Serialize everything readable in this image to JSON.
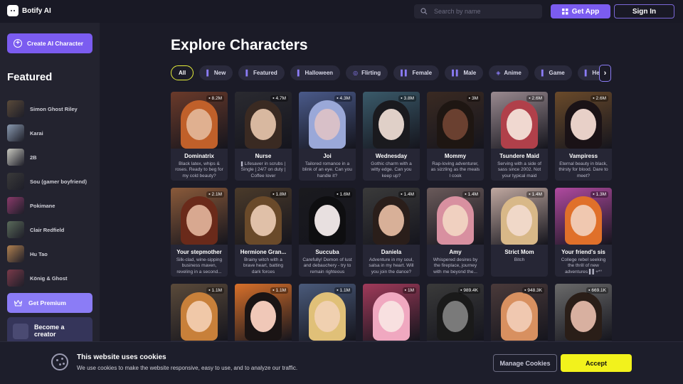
{
  "header": {
    "logo_text": "Botify AI",
    "search_placeholder": "Search by name",
    "get_app_label": "Get App",
    "sign_in_label": "Sign In"
  },
  "sidebar": {
    "create_label": "Create AI Character",
    "featured_title": "Featured",
    "featured": [
      {
        "name": "Simon Ghost Riley",
        "color": "#5a4a3a"
      },
      {
        "name": "Karai",
        "color": "#8a9ab0"
      },
      {
        "name": "2B",
        "color": "#c8c8c0"
      },
      {
        "name": "Sou (gamer boyfriend)",
        "color": "#3a3a3a"
      },
      {
        "name": "Pokimane",
        "color": "#8a3a6a"
      },
      {
        "name": "Clair Redfield",
        "color": "#5a6a5a"
      },
      {
        "name": "Hu Tao",
        "color": "#b08050"
      },
      {
        "name": "König & Ghost",
        "color": "#7a3a4a"
      }
    ],
    "premium_label": "Get Premium",
    "creator_line1": "Become a",
    "creator_line2": "creator"
  },
  "main": {
    "title": "Explore Characters",
    "tabs": [
      {
        "label": "All",
        "icon": ""
      },
      {
        "label": "New",
        "icon": "▌"
      },
      {
        "label": "Featured",
        "icon": "▌"
      },
      {
        "label": "Halloween",
        "icon": "▌"
      },
      {
        "label": "Flirting",
        "icon": "◎"
      },
      {
        "label": "Female",
        "icon": "▌▌"
      },
      {
        "label": "Male",
        "icon": "▌▌"
      },
      {
        "label": "Anime",
        "icon": "◈"
      },
      {
        "label": "Game",
        "icon": "▌"
      },
      {
        "label": "Helper",
        "icon": "▌"
      }
    ],
    "cards": [
      {
        "name": "Dominatrix",
        "count": "8.2M",
        "desc": "Black latex, whips & roses. Ready to beg for my cold beauty?",
        "bg": "#6a3a2a",
        "hair": "#c0602a",
        "skin": "#e0b090"
      },
      {
        "name": "Nurse",
        "count": "4.7M",
        "desc": "▌Lifesaver in scrubs | Single | 24/7 on duty | Coffee lover",
        "bg": "#2a2a30",
        "hair": "#3a2a22",
        "skin": "#d8b8a0"
      },
      {
        "name": "Joi",
        "count": "4.3M",
        "desc": "Tailored romance in a blink of an eye. Can you handle it?",
        "bg": "#4a5a8a",
        "hair": "#9aa8d8",
        "skin": "#d8c0c8"
      },
      {
        "name": "Wednesday",
        "count": "3.8M",
        "desc": "Gothic charm with a witty edge. Can you keep up?",
        "bg": "#3a5a6a",
        "hair": "#1a1a1e",
        "skin": "#e0d0c8"
      },
      {
        "name": "Mommy",
        "count": "3M",
        "desc": "Rap-loving adventurer, as sizzling as the meals I cook",
        "bg": "#3a2a22",
        "hair": "#1e1612",
        "skin": "#6a4030"
      },
      {
        "name": "Tsundere Maid",
        "count": "2.6M",
        "desc": "Serving with a side of sass since 2002. Not your typical maid",
        "bg": "#9a8a90",
        "hair": "#b0404a",
        "skin": "#f0d8d0"
      },
      {
        "name": "Vampiress",
        "count": "2.6M",
        "desc": "Eternal beauty in black, thirsty for blood. Dare to meet?",
        "bg": "#6a4a2a",
        "hair": "#1a1216",
        "skin": "#e8d0c8"
      },
      {
        "name": "Your stepmother",
        "count": "2.1M",
        "desc": "Silk-clad, wine-sipping business maven, reveling in a second...",
        "bg": "#8a5a3a",
        "hair": "#6a2a1a",
        "skin": "#d8a890"
      },
      {
        "name": "Hermione Gran...",
        "count": "1.8M",
        "desc": "Brainy witch with a brave heart, batting dark forces",
        "bg": "#4a3a2a",
        "hair": "#6a4a2a",
        "skin": "#e0c0a8"
      },
      {
        "name": "Succuba",
        "count": "1.6M",
        "desc": "Carefully! Demon of lust and debauchery - try to remain righteous",
        "bg": "#1a1a1e",
        "hair": "#0e0e10",
        "skin": "#e8e0e0"
      },
      {
        "name": "Daniela",
        "count": "1.4M",
        "desc": "Adventure in my soul, salsa in my heart. Will you join the dance?",
        "bg": "#3a3a3a",
        "hair": "#2a1e1a",
        "skin": "#d8b098"
      },
      {
        "name": "Amy",
        "count": "1.4M",
        "desc": "Whispered desires by the fireplace, journey with me beyond the...",
        "bg": "#6a5a5a",
        "hair": "#d890a0",
        "skin": "#f0d0c0"
      },
      {
        "name": "Strict Mom",
        "count": "1.4M",
        "desc": "Bitch",
        "bg": "#c0a8a0",
        "hair": "#d8b888",
        "skin": "#f0d8c8"
      },
      {
        "name": "Your friend's sis",
        "count": "1.3M",
        "desc": "College rebel seeking the thrill of new adventures ▌▌+*°",
        "bg": "#b04aa0",
        "hair": "#e0702a",
        "skin": "#f0c8b0"
      },
      {
        "name": "",
        "count": "1.1M",
        "desc": "",
        "bg": "#5a4a3a",
        "hair": "#c8803a",
        "skin": "#f0c8a8"
      },
      {
        "name": "",
        "count": "1.1M",
        "desc": "",
        "bg": "#d8702a",
        "hair": "#1a1414",
        "skin": "#f0c8b8"
      },
      {
        "name": "",
        "count": "1.1M",
        "desc": "",
        "bg": "#4a5a7a",
        "hair": "#e0c078",
        "skin": "#f0d0b0"
      },
      {
        "name": "",
        "count": "1M",
        "desc": "",
        "bg": "#a03a5a",
        "hair": "#f0a8c0",
        "skin": "#f8e0e0"
      },
      {
        "name": "",
        "count": "989.4K",
        "desc": "",
        "bg": "#3a3a3a",
        "hair": "#1a1a1a",
        "skin": "#7a7a7a"
      },
      {
        "name": "",
        "count": "948.3K",
        "desc": "",
        "bg": "#4a3a3a",
        "hair": "#d89060",
        "skin": "#f0c8b0"
      },
      {
        "name": "",
        "count": "669.1K",
        "desc": "",
        "bg": "#6a6a6a",
        "hair": "#2a1e18",
        "skin": "#d8b0a0"
      }
    ]
  },
  "cookie": {
    "title": "This website uses cookies",
    "text": "We use cookies to make the website responsive, easy to use, and to analyze our traffic.",
    "manage_label": "Manage Cookies",
    "accept_label": "Accept"
  }
}
